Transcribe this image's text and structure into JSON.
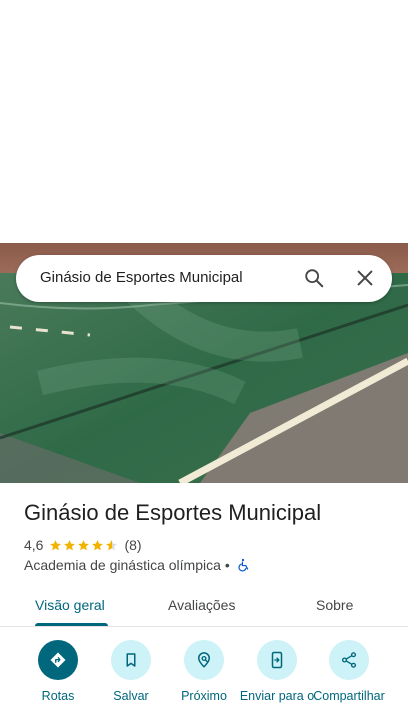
{
  "search": {
    "query": "Ginásio de Esportes Municipal"
  },
  "place": {
    "title": "Ginásio de Esportes Municipal",
    "rating": "4,6",
    "rating_fraction": 0.92,
    "review_count": "(8)",
    "category": "Academia de ginástica olímpica",
    "separator": "•"
  },
  "tabs": [
    {
      "label": "Visão geral",
      "active": true
    },
    {
      "label": "Avaliações",
      "active": false
    },
    {
      "label": "Sobre",
      "active": false
    }
  ],
  "actions": [
    {
      "label": "Rotas",
      "icon": "directions-icon"
    },
    {
      "label": "Salvar",
      "icon": "bookmark-icon"
    },
    {
      "label": "Próximo",
      "icon": "nearby-icon"
    },
    {
      "label": "Enviar para o",
      "icon": "send-to-phone-icon"
    },
    {
      "label": "Compartilhar",
      "icon": "share-icon"
    }
  ],
  "colors": {
    "accent": "#00677d",
    "action_bg": "#cdf2f7",
    "star": "#f2b300"
  }
}
